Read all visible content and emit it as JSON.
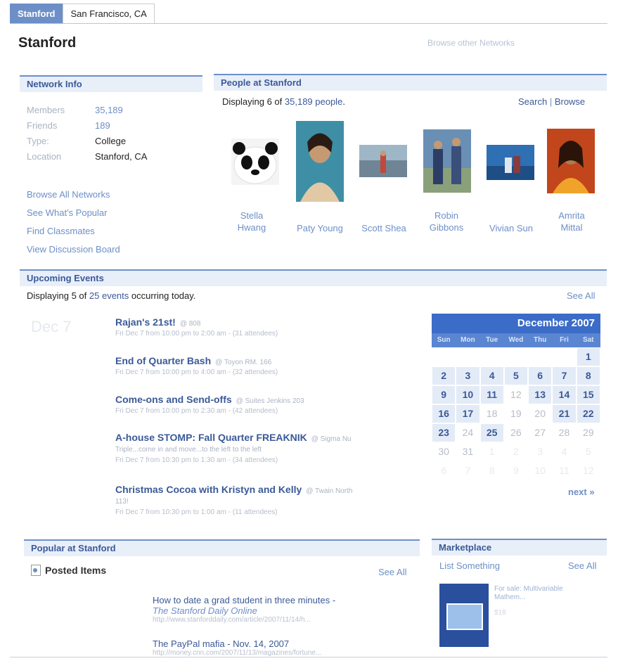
{
  "tabs": [
    {
      "label": "Stanford",
      "active": true
    },
    {
      "label": "San Francisco, CA",
      "active": false
    }
  ],
  "page": {
    "title": "Stanford",
    "browse_other": "Browse other Networks"
  },
  "network_info": {
    "heading": "Network Info",
    "rows": [
      {
        "key": "Members",
        "value": "35,189"
      },
      {
        "key": "Friends",
        "value": "189"
      },
      {
        "key": "Type:",
        "value": "College"
      },
      {
        "key": "Location",
        "value": "Stanford, CA"
      }
    ],
    "links": [
      "Browse All Networks",
      "See What's Popular",
      "Find Classmates",
      "View Discussion Board"
    ]
  },
  "people": {
    "heading": "People at Stanford",
    "caption_prefix": "Displaying 6 of ",
    "caption_count": "35,189 people",
    "caption_suffix": ".",
    "search_label": "Search",
    "separator": " | ",
    "browse_label": "Browse",
    "list": [
      {
        "name": "Stella Hwang",
        "colors": [
          "#e7e9ea",
          "#111111"
        ]
      },
      {
        "name": "Paty Young",
        "colors": [
          "#3e8fa5",
          "#e2c9a6"
        ]
      },
      {
        "name": "Scott Shea",
        "colors": [
          "#8aa3b5",
          "#c0483c"
        ]
      },
      {
        "name": "Robin Gibbons",
        "colors": [
          "#6a8fb4",
          "#2c3e66"
        ]
      },
      {
        "name": "Vivian Sun",
        "colors": [
          "#2f6fb3",
          "#e0e6ef"
        ]
      },
      {
        "name": "Amrita Mittal",
        "colors": [
          "#c2461b",
          "#f0a32a"
        ]
      }
    ]
  },
  "events": {
    "heading": "Upcoming Events",
    "caption_prefix": "Displaying 5 of ",
    "caption_count": "25 events",
    "caption_suffix": " occurring today.",
    "see_all": "See All",
    "month_ghost": "Dec 7",
    "items": [
      {
        "title": "Rajan's 21st!",
        "location": "@ 808",
        "desc": "",
        "time": "Fri Dec 7 from 10:00 pm to 2:00 am - (31 attendees)"
      },
      {
        "title": "End of Quarter Bash",
        "location": "@ Toyon RM. 166",
        "desc": "",
        "time": "Fri Dec 7 from 10:00 pm to 4:00 am - (32 attendees)"
      },
      {
        "title": "Come-ons and Send-offs",
        "location": "@ Suites Jenkins 203",
        "desc": "",
        "time": "Fri Dec 7 from 10:00 pm to 2:30 am - (42 attendees)"
      },
      {
        "title": "A-house STOMP: Fall Quarter FREAKNIK",
        "location": "@ Sigma Nu",
        "desc": "Triple...come in and move...to the left to the left",
        "time": "Fri Dec 7 from 10:30 pm to 1:30 am - (34 attendees)"
      },
      {
        "title": "Christmas Cocoa with Kristyn and Kelly",
        "location": "@ Twain North",
        "desc": "113!",
        "time": "Fri Dec 7 from 10:30 pm to 1:00 am - (11 attendees)"
      }
    ]
  },
  "calendar": {
    "month": "December 2007",
    "days": [
      "Sun",
      "Mon",
      "Tue",
      "Wed",
      "Thu",
      "Fri",
      "Sat"
    ],
    "cells": [
      {
        "d": "",
        "t": "faint"
      },
      {
        "d": "",
        "t": "faint"
      },
      {
        "d": "",
        "t": "faint"
      },
      {
        "d": "",
        "t": "faint"
      },
      {
        "d": "",
        "t": "faint"
      },
      {
        "d": "",
        "t": "faint"
      },
      {
        "d": "1",
        "t": "ev"
      },
      {
        "d": "2",
        "t": "ev"
      },
      {
        "d": "3",
        "t": "ev"
      },
      {
        "d": "4",
        "t": "ev"
      },
      {
        "d": "5",
        "t": "ev"
      },
      {
        "d": "6",
        "t": "ev"
      },
      {
        "d": "7",
        "t": "ev"
      },
      {
        "d": "8",
        "t": "ev"
      },
      {
        "d": "9",
        "t": "ev"
      },
      {
        "d": "10",
        "t": "ev"
      },
      {
        "d": "11",
        "t": "ev"
      },
      {
        "d": "12",
        "t": "plain"
      },
      {
        "d": "13",
        "t": "ev"
      },
      {
        "d": "14",
        "t": "ev"
      },
      {
        "d": "15",
        "t": "ev"
      },
      {
        "d": "16",
        "t": "ev"
      },
      {
        "d": "17",
        "t": "ev"
      },
      {
        "d": "18",
        "t": "plain"
      },
      {
        "d": "19",
        "t": "plain"
      },
      {
        "d": "20",
        "t": "plain"
      },
      {
        "d": "21",
        "t": "ev"
      },
      {
        "d": "22",
        "t": "ev"
      },
      {
        "d": "23",
        "t": "ev"
      },
      {
        "d": "24",
        "t": "plain"
      },
      {
        "d": "25",
        "t": "ev"
      },
      {
        "d": "26",
        "t": "plain"
      },
      {
        "d": "27",
        "t": "plain"
      },
      {
        "d": "28",
        "t": "plain"
      },
      {
        "d": "29",
        "t": "plain"
      },
      {
        "d": "30",
        "t": "plain"
      },
      {
        "d": "31",
        "t": "plain"
      },
      {
        "d": "1",
        "t": "faint"
      },
      {
        "d": "2",
        "t": "faint"
      },
      {
        "d": "3",
        "t": "faint"
      },
      {
        "d": "4",
        "t": "faint"
      },
      {
        "d": "5",
        "t": "faint"
      },
      {
        "d": "6",
        "t": "faint"
      },
      {
        "d": "7",
        "t": "faint"
      },
      {
        "d": "8",
        "t": "faint"
      },
      {
        "d": "9",
        "t": "faint"
      },
      {
        "d": "10",
        "t": "faint"
      },
      {
        "d": "11",
        "t": "faint"
      },
      {
        "d": "12",
        "t": "faint"
      }
    ],
    "next": "next »"
  },
  "popular": {
    "heading": "Popular at Stanford",
    "section": "Posted Items",
    "see_all": "See All",
    "items": [
      {
        "title": "How to date a grad student in three minutes -",
        "source": "The Stanford Daily Online",
        "url": "http://www.stanforddaily.com/article/2007/11/14/h..."
      },
      {
        "title": "The PayPal mafia - Nov. 14, 2007",
        "source": "",
        "url": "http://money.cnn.com/2007/11/13/magazines/fortune..."
      }
    ]
  },
  "marketplace": {
    "heading": "Marketplace",
    "list_something": "List Something",
    "see_all": "See All",
    "item_title": "For sale: Multivariable Mathem...",
    "item_price": "$18"
  },
  "colors": {
    "accent": "#3b5998",
    "link": "#6d8fc7",
    "header_bg": "#e8eff9",
    "calendar_head": "#3b6cc7"
  }
}
